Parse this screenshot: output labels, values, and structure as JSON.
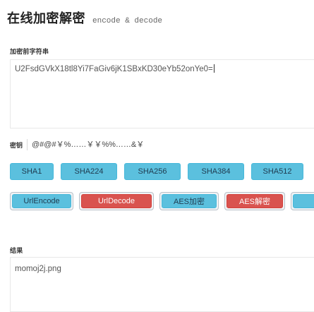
{
  "header": {
    "title": "在线加密解密",
    "subtitle": "encode & decode"
  },
  "plaintext": {
    "label": "加密前字符串",
    "value": "U2FsdGVkX18tl8Yi7FaGiv6jK1SBxKD30eYb52onYe0="
  },
  "key": {
    "label": "密钥",
    "value": "@#@#￥%……￥￥%%……&￥"
  },
  "hash_buttons": [
    {
      "label": "SHA1"
    },
    {
      "label": "SHA224"
    },
    {
      "label": "SHA256"
    },
    {
      "label": "SHA384"
    },
    {
      "label": "SHA512"
    }
  ],
  "action_buttons": {
    "url_encode": "UrlEncode",
    "url_decode": "UrlDecode",
    "aes_encrypt": "AES加密",
    "aes_decrypt": "AES解密"
  },
  "result": {
    "label": "结果",
    "value": "momoj2j.png"
  },
  "colors": {
    "info": "#5bc0de",
    "danger": "#d9534f"
  }
}
